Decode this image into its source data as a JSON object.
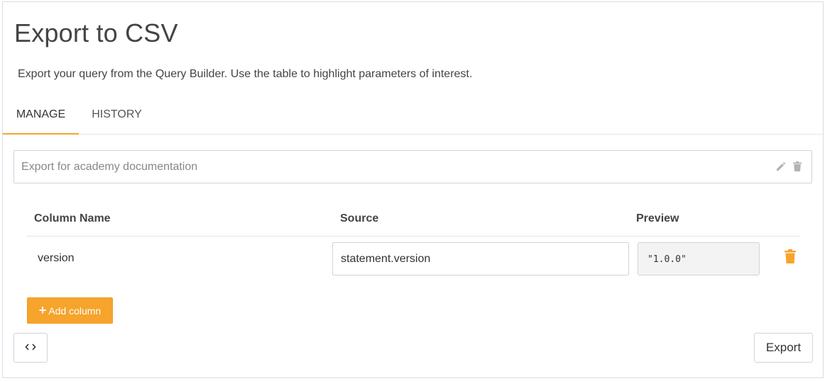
{
  "header": {
    "title": "Export to CSV",
    "description": "Export your query from the Query Builder. Use the table to highlight parameters of interest."
  },
  "tabs": [
    {
      "label": "MANAGE",
      "active": true
    },
    {
      "label": "HISTORY",
      "active": false
    }
  ],
  "export_name": {
    "placeholder": "Export for academy documentation",
    "value": "",
    "icons": [
      "pencil-icon",
      "trash-icon"
    ]
  },
  "table": {
    "headers": {
      "name": "Column Name",
      "source": "Source",
      "preview": "Preview"
    },
    "rows": [
      {
        "name": "version",
        "source": "statement.version",
        "preview": "\"1.0.0\""
      }
    ]
  },
  "buttons": {
    "add_column": "Add column",
    "export": "Export",
    "code_icon": "code-brackets-icon"
  },
  "colors": {
    "accent": "#f6a42c",
    "border": "#cfd4d9",
    "icon_gray": "#b3b3b3"
  }
}
